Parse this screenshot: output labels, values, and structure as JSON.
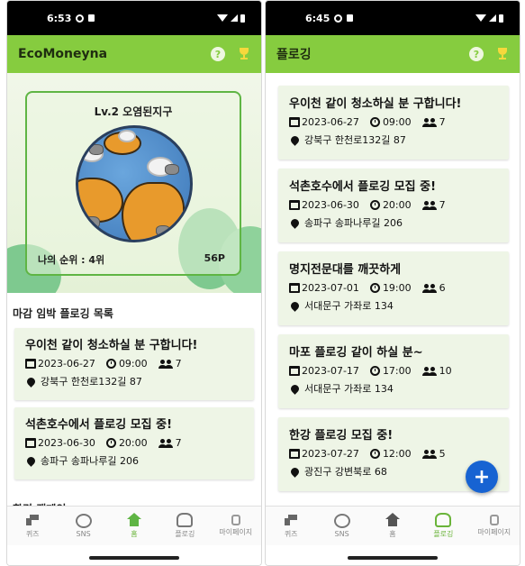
{
  "left_screen": {
    "status_time": "6:53",
    "app_title": "EcoMoneyna",
    "level_label": "Lv.2 오염된지구",
    "rank_label": "나의 순위 : 4위",
    "points": "56P",
    "deadline_section_title": "마감 임박 플로깅 목록",
    "cards": [
      {
        "title": "우이천 같이 청소하실 분 구합니다!",
        "date": "2023-06-27",
        "time": "09:00",
        "people": "7",
        "location": "강북구 한천로132길 87"
      },
      {
        "title": "석촌호수에서 플로깅 모집 중!",
        "date": "2023-06-30",
        "time": "20:00",
        "people": "7",
        "location": "송파구 송파나루길 206"
      }
    ],
    "campaign_section_title": "환경 캠페인"
  },
  "right_screen": {
    "status_time": "6:45",
    "app_title": "플로깅",
    "cards": [
      {
        "title": "우이천 같이 청소하실 분 구합니다!",
        "date": "2023-06-27",
        "time": "09:00",
        "people": "7",
        "location": "강북구 한천로132길 87"
      },
      {
        "title": "석촌호수에서 플로깅 모집 중!",
        "date": "2023-06-30",
        "time": "20:00",
        "people": "7",
        "location": "송파구 송파나루길 206"
      },
      {
        "title": "명지전문대를 깨끗하게",
        "date": "2023-07-01",
        "time": "19:00",
        "people": "6",
        "location": "서대문구 가좌로 134"
      },
      {
        "title": "마포 플로깅 같이 하실 분~",
        "date": "2023-07-17",
        "time": "17:00",
        "people": "10",
        "location": "서대문구 가좌로 134"
      },
      {
        "title": "한강 플로깅 모집 중!",
        "date": "2023-07-27",
        "time": "12:00",
        "people": "5",
        "location": "광진구 강변북로 68"
      }
    ],
    "fab_label": "+"
  },
  "nav": {
    "items": [
      "퀴즈",
      "SNS",
      "홈",
      "플로깅",
      "마이페이지"
    ]
  },
  "help_label": "?",
  "colors": {
    "accent": "#86cc3f",
    "card_bg": "#eef5e6",
    "fab": "#1763d2"
  }
}
